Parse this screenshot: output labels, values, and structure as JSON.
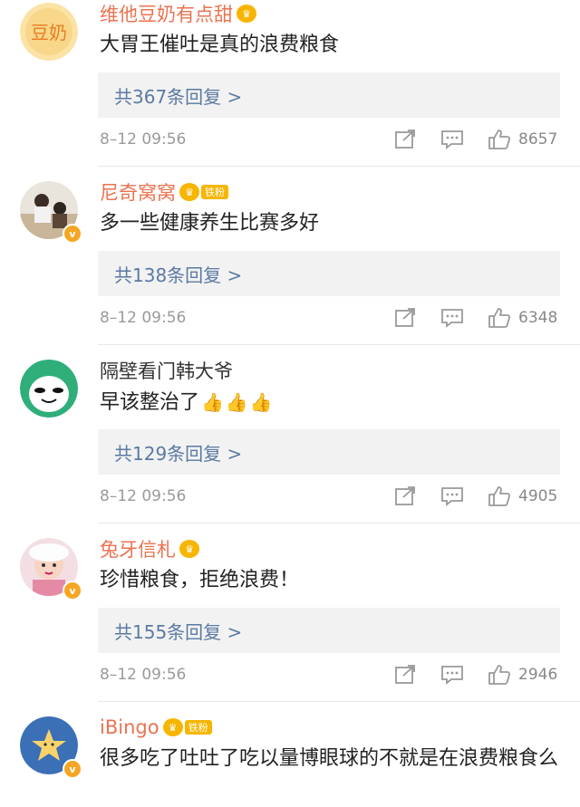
{
  "comments": [
    {
      "name": "维他豆奶有点甜",
      "name_style": "vip",
      "crown": true,
      "fan_badge": "",
      "verified": false,
      "avatar_text": "豆奶",
      "text": "大胃王催吐是真的浪费粮食",
      "thumbs": 0,
      "replies": "共367条回复 >",
      "time": "8–12 09:56",
      "likes": "8657"
    },
    {
      "name": "尼奇窝窝",
      "name_style": "vip",
      "crown": true,
      "fan_badge": "铁粉",
      "verified": true,
      "avatar_text": "",
      "text": "多一些健康养生比赛多好",
      "thumbs": 0,
      "replies": "共138条回复 >",
      "time": "8–12 09:56",
      "likes": "6348"
    },
    {
      "name": "隔壁看门韩大爷",
      "name_style": "plain",
      "crown": false,
      "fan_badge": "",
      "verified": false,
      "avatar_text": "",
      "text": "早该整治了",
      "thumbs": 3,
      "replies": "共129条回复 >",
      "time": "8–12 09:56",
      "likes": "4905"
    },
    {
      "name": "兔牙信札",
      "name_style": "vip",
      "crown": true,
      "fan_badge": "",
      "verified": true,
      "avatar_text": "",
      "text": "珍惜粮食，拒绝浪费！",
      "thumbs": 0,
      "replies": "共155条回复 >",
      "time": "8–12 09:56",
      "likes": "2946"
    },
    {
      "name": "iBingo",
      "name_style": "vip",
      "crown": true,
      "fan_badge": "铁粉",
      "verified": true,
      "avatar_text": "",
      "text": "很多吃了吐吐了吃以量博眼球的不就是在浪费粮食么",
      "thumbs": 0,
      "replies": "",
      "time": "",
      "likes": ""
    }
  ],
  "colors": {
    "vip_name": "#eb7350",
    "reply_link": "#5b7aa3",
    "badge": "#f7b500",
    "verified": "#f5a623"
  },
  "icons": {
    "share": "share-icon",
    "comment": "comment-icon",
    "like": "like-icon",
    "thumbs": "thumbs-up-emoji"
  }
}
